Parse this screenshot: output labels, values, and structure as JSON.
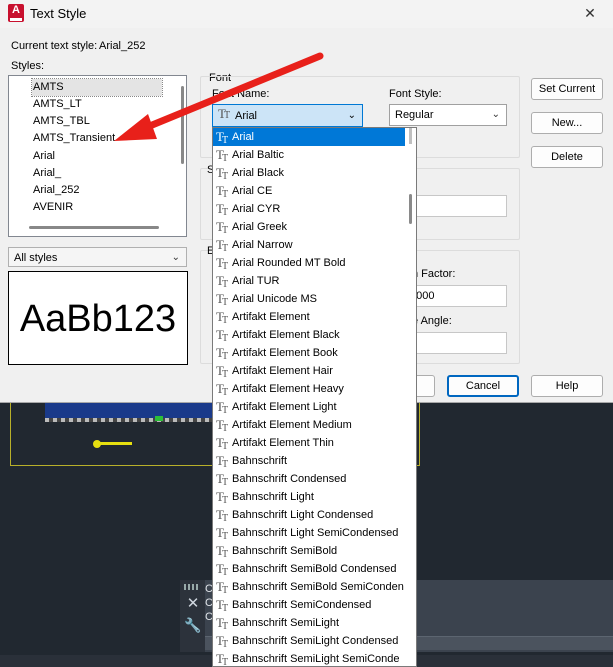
{
  "dialog": {
    "title": "Text Style",
    "close_glyph": "✕",
    "current_style_label": "Current text style:",
    "current_style_value": "Arial_252",
    "styles_label": "Styles:",
    "styles": [
      "AMTS",
      "AMTS_LT",
      "AMTS_TBL",
      "AMTS_Transient",
      "Arial",
      "Arial_",
      "Arial_252",
      "AVENIR"
    ],
    "selected_style": "AMTS",
    "filter_value": "All styles",
    "preview_text": "AaBb123",
    "font_group_label": "Font",
    "font_name_label": "Font Name:",
    "font_name_value": "Arial",
    "font_style_label": "Font Style:",
    "font_style_value": "Regular",
    "size_group_fragment": "S",
    "effects_group_fragment": "E",
    "height_fragment": "t",
    "width_factor_fragment": "n Factor:",
    "width_factor_value": "0000",
    "oblique_fragment": "e Angle:",
    "buttons": {
      "set_current": "Set Current",
      "new": "New...",
      "delete": "Delete",
      "cancel": "Cancel",
      "help": "Help"
    }
  },
  "font_dropdown": {
    "items": [
      "Arial",
      "Arial Baltic",
      "Arial Black",
      "Arial CE",
      "Arial CYR",
      "Arial Greek",
      "Arial Narrow",
      "Arial Rounded MT Bold",
      "Arial TUR",
      "Arial Unicode MS",
      "Artifakt Element",
      "Artifakt Element Black",
      "Artifakt Element Book",
      "Artifakt Element Hair",
      "Artifakt Element Heavy",
      "Artifakt Element Light",
      "Artifakt Element Medium",
      "Artifakt Element Thin",
      "Bahnschrift",
      "Bahnschrift Condensed",
      "Bahnschrift Light",
      "Bahnschrift Light Condensed",
      "Bahnschrift Light SemiCondensed",
      "Bahnschrift SemiBold",
      "Bahnschrift SemiBold Condensed",
      "Bahnschrift SemiBold SemiConden",
      "Bahnschrift SemiCondensed",
      "Bahnschrift SemiLight",
      "Bahnschrift SemiLight Condensed",
      "Bahnschrift SemiLight SemiConde"
    ],
    "selected": "Arial",
    "truetype_icon": "truetype-font-icon"
  },
  "command_panel": {
    "close_glyph": "✕",
    "wrench_glyph": "🔧",
    "lines": [
      "C",
      "C",
      "C"
    ]
  },
  "colors": {
    "selection_blue": "#0078d7",
    "annotation_arrow": "#e8201a",
    "cad_background": "#212830",
    "cad_yellow": "#e6df10"
  },
  "annotation": {
    "type": "arrow",
    "points_to": "AMTS_Transient"
  }
}
